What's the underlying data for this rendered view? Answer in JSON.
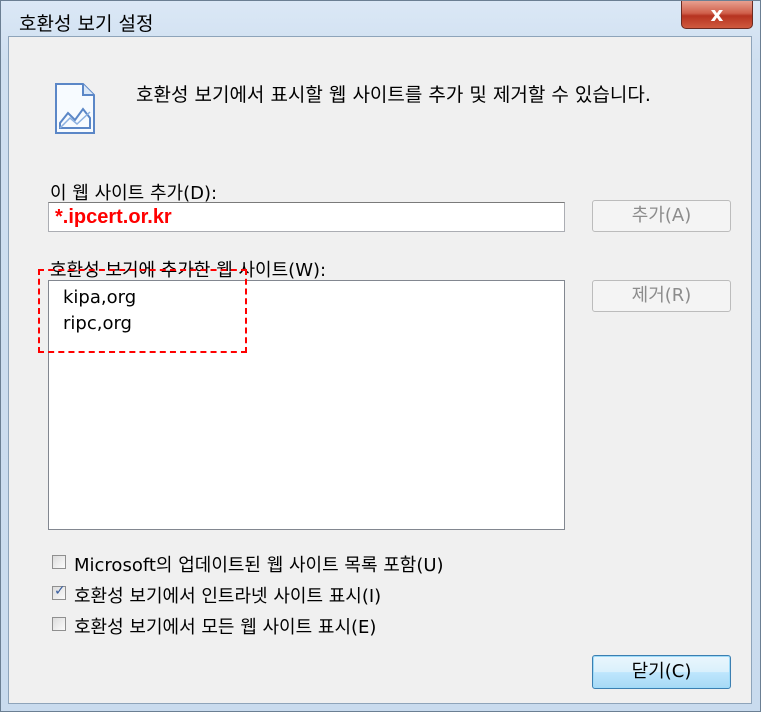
{
  "window": {
    "title": "호환성 보기 설정",
    "close_glyph": "x"
  },
  "description": "호환성 보기에서 표시할 웹 사이트를 추가 및 제거할 수 있습니다.",
  "add_section": {
    "label": "이 웹 사이트 추가(D):",
    "input_value": "*.ipcert.or.kr",
    "add_button": "추가(A)"
  },
  "list_section": {
    "label": "호환성 보기에 추가한 웹 사이트(W):",
    "items": [
      "kipa,org",
      "ripc,org"
    ],
    "remove_button": "제거(R)"
  },
  "options": [
    {
      "label": "Microsoft의 업데이트된 웹 사이트 목록 포함(U)",
      "checked": false
    },
    {
      "label": "호환성 보기에서 인트라넷 사이트 표시(I)",
      "checked": true
    },
    {
      "label": "호환성 보기에서 모든 웹 사이트 표시(E)",
      "checked": false
    }
  ],
  "close_button": "닫기(C)",
  "colors": {
    "highlight": "#ff0000",
    "input_text": "#ff0000"
  }
}
